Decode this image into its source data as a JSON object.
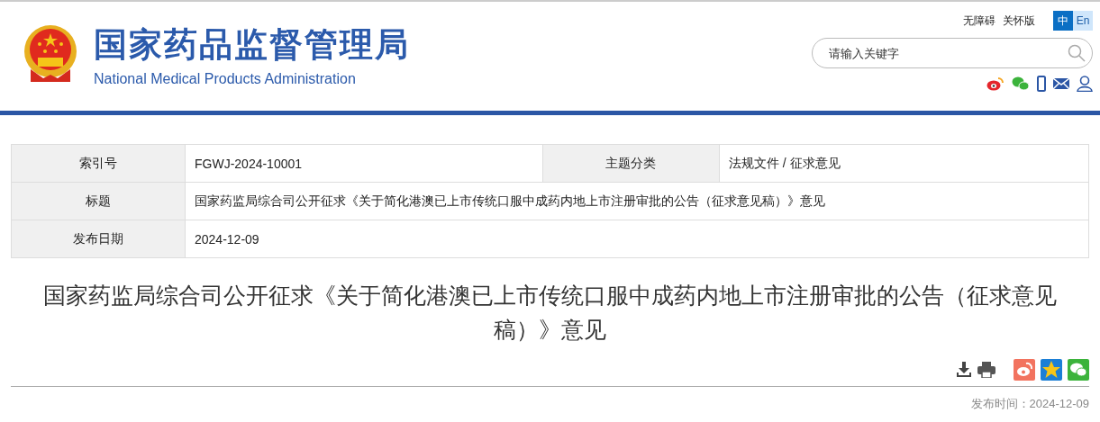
{
  "header": {
    "title_cn": "国家药品监督管理局",
    "title_en": "National Medical Products Administration",
    "links": [
      "无障碍",
      "关怀版"
    ],
    "languages": [
      {
        "label": "中",
        "selected": true
      },
      {
        "label": "En",
        "selected": false
      }
    ],
    "search": {
      "placeholder": "请输入关键字"
    }
  },
  "info_table": {
    "rows": [
      {
        "cells": [
          {
            "label": "索引号",
            "value": "FGWJ-2024-10001"
          },
          {
            "label": "主题分类",
            "value": "法规文件 / 征求意见"
          }
        ]
      },
      {
        "cells": [
          {
            "label": "标题",
            "value": "国家药监局综合司公开征求《关于简化港澳已上市传统口服中成药内地上市注册审批的公告（征求意见稿）》意见"
          }
        ]
      },
      {
        "cells": [
          {
            "label": "发布日期",
            "value": "2024-12-09"
          }
        ]
      }
    ]
  },
  "article": {
    "title": "国家药监局综合司公开征求《关于简化港澳已上市传统口服中成药内地上市注册审批的公告（征求意见稿）》意见",
    "date": "发布时间：2024-12-09"
  }
}
